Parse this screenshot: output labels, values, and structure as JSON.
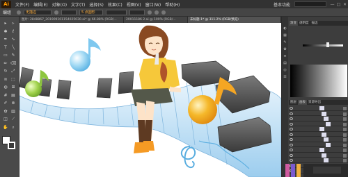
{
  "app": {
    "logo": "Ai",
    "menus": [
      "文件(F)",
      "编辑(E)",
      "对象(O)",
      "文字(T)",
      "选择(S)",
      "效果(C)",
      "视图(V)",
      "窗口(W)",
      "帮助(H)"
    ],
    "workspace_label": "基本功能",
    "window_buttons": [
      "—",
      "□",
      "✕"
    ]
  },
  "control_bar": {
    "selection_label": "编组",
    "field_1": "无描边",
    "field_2": "5 点圆形"
  },
  "tabs": [
    {
      "label": "图片: 2848867_201909101154025030.ai* @ 66.88% (RGB/...",
      "active": false
    },
    {
      "label": "20011186 2.ai @ 100% (RGB/...",
      "active": false
    },
    {
      "label": "未标题-1* @ 311.2% (RGB/预览)",
      "active": true
    }
  ],
  "tools": [
    {
      "name": "selection-tool",
      "glyph": "▸"
    },
    {
      "name": "direct-selection-tool",
      "glyph": "▹"
    },
    {
      "name": "magic-wand-tool",
      "glyph": "✱"
    },
    {
      "name": "lasso-tool",
      "glyph": "ℓ"
    },
    {
      "name": "pen-tool",
      "glyph": "✒"
    },
    {
      "name": "curvature-tool",
      "glyph": "∿"
    },
    {
      "name": "type-tool",
      "glyph": "T"
    },
    {
      "name": "line-tool",
      "glyph": "╲"
    },
    {
      "name": "rectangle-tool",
      "glyph": "▭"
    },
    {
      "name": "paintbrush-tool",
      "glyph": "✎"
    },
    {
      "name": "pencil-tool",
      "glyph": "✏"
    },
    {
      "name": "eraser-tool",
      "glyph": "⌫"
    },
    {
      "name": "rotate-tool",
      "glyph": "↻"
    },
    {
      "name": "scale-tool",
      "glyph": "⤢"
    },
    {
      "name": "warp-tool",
      "glyph": "≋"
    },
    {
      "name": "free-transform-tool",
      "glyph": "⬚"
    },
    {
      "name": "shape-builder-tool",
      "glyph": "◍"
    },
    {
      "name": "perspective-tool",
      "glyph": "⊞"
    },
    {
      "name": "mesh-tool",
      "glyph": "#"
    },
    {
      "name": "gradient-tool",
      "glyph": "▤"
    },
    {
      "name": "eyedropper-tool",
      "glyph": "✐"
    },
    {
      "name": "blend-tool",
      "glyph": "⊗"
    },
    {
      "name": "symbol-sprayer-tool",
      "glyph": "✿"
    },
    {
      "name": "graph-tool",
      "glyph": "▥"
    },
    {
      "name": "artboard-tool",
      "glyph": "◫"
    },
    {
      "name": "slice-tool",
      "glyph": "⟋"
    },
    {
      "name": "hand-tool",
      "glyph": "✋"
    },
    {
      "name": "zoom-tool",
      "glyph": "⌕"
    }
  ],
  "swatches": {
    "fill": "#ffffff",
    "stroke_none": "#e02020"
  },
  "right_panel": {
    "gradient_tabs": [
      "渐变",
      "透明度",
      "描边"
    ],
    "layers_tabs": [
      "图层",
      "画板",
      "资源导出"
    ]
  },
  "colors": {
    "key_blue": "#d9ecfa",
    "key_black": "#555555",
    "note_orange": "#f5a623",
    "note_green": "#8dc63f",
    "note_blue": "#7ec8ef"
  }
}
